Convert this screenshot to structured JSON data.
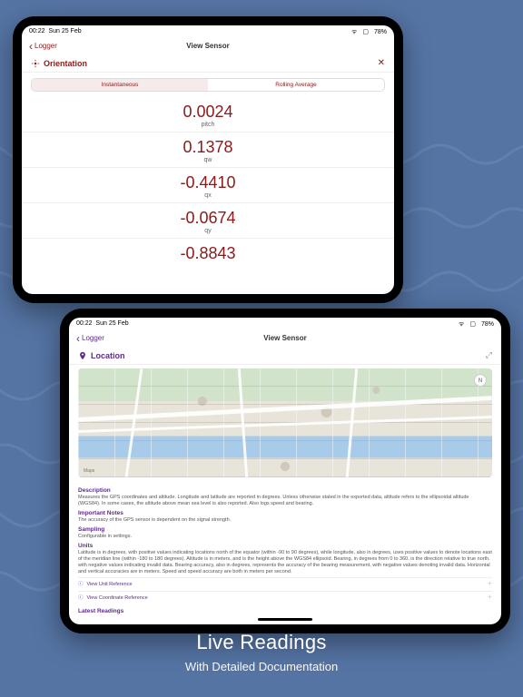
{
  "caption": {
    "title": "Live Readings",
    "subtitle": "With Detailed Documentation"
  },
  "status": {
    "time": "00:22",
    "date": "Sun 25 Feb",
    "battery": "78%"
  },
  "tablet1": {
    "back_label": "Logger",
    "nav_title": "View Sensor",
    "sensor_name": "Orientation",
    "seg_a": "Instantaneous",
    "seg_b": "Rolling Average",
    "readings": [
      {
        "value": "0.0024",
        "label": "pitch"
      },
      {
        "value": "0.1378",
        "label": "qw"
      },
      {
        "value": "-0.4410",
        "label": "qx"
      },
      {
        "value": "-0.0674",
        "label": "qy"
      },
      {
        "value": "-0.8843",
        "label": ""
      }
    ]
  },
  "tablet2": {
    "back_label": "Logger",
    "nav_title": "View Sensor",
    "sensor_name": "Location",
    "compass": "N",
    "map_attr": "Maps",
    "docs": {
      "desc_h": "Description",
      "desc_p": "Measures the GPS coordinates and altitude. Longitude and latitude are reported in degrees. Unless otherwise stated in the exported data, altitude refers to the ellipsoidal altitude (WGS84). In some cases, the altitude above mean sea level is also reported. Also logs speed and bearing.",
      "notes_h": "Important Notes",
      "notes_p": "The accuracy of the GPS sensor is dependent on the signal strength.",
      "samp_h": "Sampling",
      "samp_p": "Configurable in settings.",
      "units_h": "Units",
      "units_p": "Latitude is in degrees, with positive values indicating locations north of the equator (within -90 to 90 degrees), while longitude, also in degrees, uses positive values to denote locations east of the meridian line (within -180 to 180 degrees). Altitude is in meters, and is the height above the WGS84 ellipsoid. Bearing, in degrees from 0 to 360, is the direction relative to true north, with negative values indicating invalid data. Bearing accuracy, also in degrees, represents the accuracy of the bearing measurement, with negative values denoting invalid data. Horizontal and vertical accuracies are in meters. Speed and speed accuracy are both in meters per second.",
      "ref1": "View Unit Reference",
      "ref2": "View Coordinate Reference",
      "latest_h": "Latest Readings"
    }
  }
}
